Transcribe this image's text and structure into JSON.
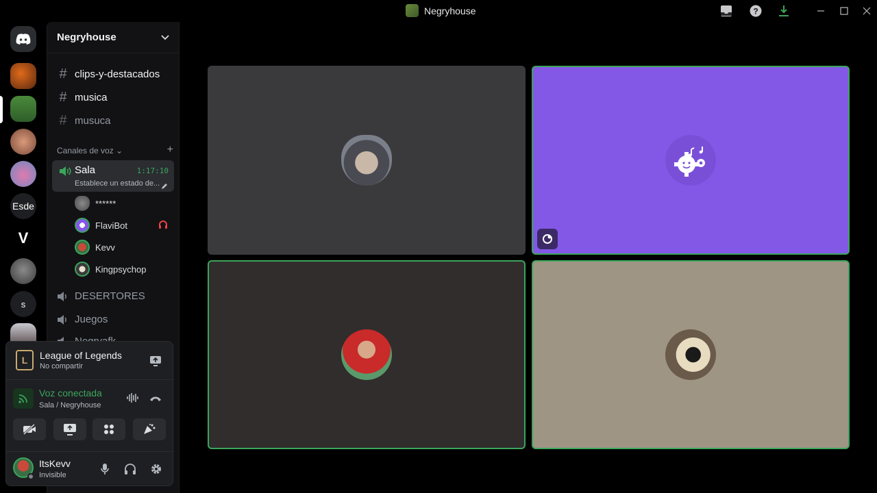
{
  "window": {
    "title": "Negryhouse"
  },
  "servers": [
    {
      "name": "server-1"
    },
    {
      "name": "server-2"
    },
    {
      "name": "server-3"
    },
    {
      "name": "server-4"
    },
    {
      "label": "Esde"
    },
    {
      "label": "V"
    },
    {
      "name": "server-7"
    },
    {
      "label": "s"
    },
    {
      "name": "server-9"
    }
  ],
  "guild": {
    "name": "Negryhouse"
  },
  "text_channels": [
    {
      "name": "clips-y-destacados"
    },
    {
      "name": "musica"
    },
    {
      "name": "musuca"
    }
  ],
  "voice_section": {
    "label": "Canales de voz"
  },
  "active_voice_channel": {
    "name": "Sala",
    "timer": "1:17:10",
    "status": "Establece un estado de..."
  },
  "members": [
    {
      "name": "******"
    },
    {
      "name": "FlaviBot"
    },
    {
      "name": "Kevv"
    },
    {
      "name": "Kingpsychop"
    }
  ],
  "voice_channels": [
    {
      "name": "DESERTORES"
    },
    {
      "name": "Juegos"
    },
    {
      "name": "Negryafk"
    }
  ],
  "activity": {
    "title": "League of Legends",
    "subtitle": "No compartir",
    "icon_letter": "L"
  },
  "voice_status": {
    "title": "Voz conectada",
    "subtitle": "Sala / Negryhouse"
  },
  "user": {
    "name": "ItsKevv",
    "status": "Invisible"
  },
  "colors": {
    "accent_green": "#3ba55c",
    "bot_tile": "#8358e6",
    "tile_dark": "#3a3a3d",
    "tile_brown": "#302d2c",
    "tile_beige": "#9f9584"
  }
}
